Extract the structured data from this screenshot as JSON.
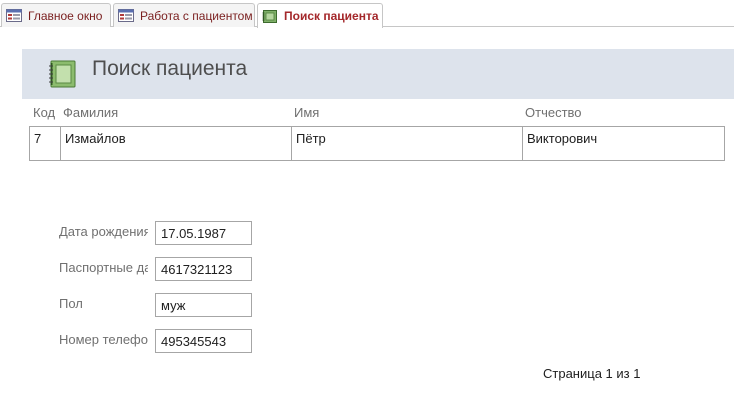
{
  "tabs": [
    {
      "label": "Главное окно",
      "icon": "form-icon",
      "active": false
    },
    {
      "label": "Работа с пациентом",
      "icon": "form-icon",
      "active": false
    },
    {
      "label": "Поиск пациента",
      "icon": "report-icon",
      "active": true
    }
  ],
  "header": {
    "title": "Поиск пациента",
    "icon": "report-icon",
    "band_color": "#dde3ec"
  },
  "table": {
    "columns": [
      "Код",
      "Фамилия",
      "Имя",
      "Отчество"
    ],
    "row": {
      "code": "7",
      "last_name": "Измайлов",
      "first_name": "Пётр",
      "patronymic": "Викторович"
    }
  },
  "fields": [
    {
      "label": "Дата рождения",
      "value": "17.05.1987"
    },
    {
      "label": "Паспортные данные",
      "value": "4617321123"
    },
    {
      "label": "Пол",
      "value": "муж"
    },
    {
      "label": "Номер телефона",
      "value": "495345543"
    }
  ],
  "footer": {
    "page_info": "Страница 1 из 1"
  },
  "colors": {
    "active_tab_text": "#a4282b",
    "tab_text": "#7a1f1f",
    "label_text": "#707070"
  }
}
